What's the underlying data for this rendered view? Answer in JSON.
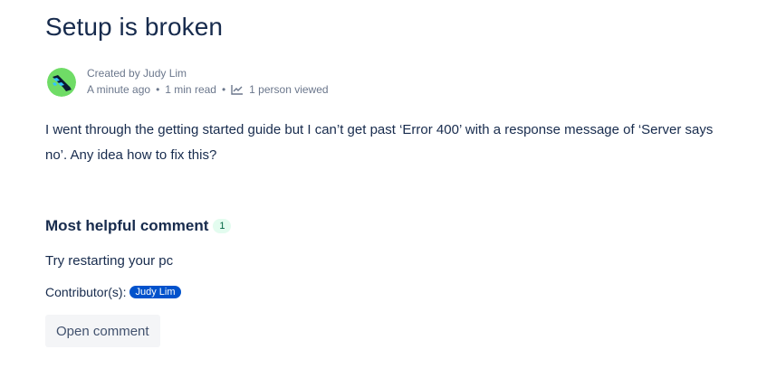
{
  "page": {
    "title": "Setup is broken",
    "byline": {
      "created_by": "Created by Judy Lim",
      "time_ago": "A minute ago",
      "read_time": "1 min read",
      "views": "1 person viewed"
    },
    "body": "I went through the getting started guide but I can’t get past ‘Error 400’ with a response message of ‘Server says no’. Any idea how to fix this?"
  },
  "comment": {
    "heading": "Most helpful comment",
    "count": "1",
    "text": "Try restarting your pc",
    "contributors_label": "Contributor(s):",
    "contributor": "Judy Lim",
    "open_button": "Open comment"
  },
  "colors": {
    "text": "#172b4d",
    "subtle": "#6b778c",
    "chip": "#0052cc",
    "badge_bg": "#e3fcef",
    "button_bg": "#f4f5f7"
  },
  "icons": {
    "avatar": "user-avatar-icon",
    "views": "chart-line-icon"
  }
}
